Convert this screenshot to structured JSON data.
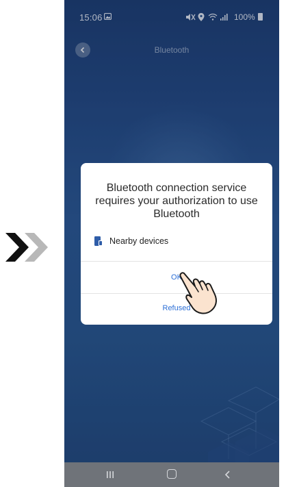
{
  "status_bar": {
    "time": "15:06",
    "battery": "100%",
    "icons": [
      "image-icon",
      "mute-icon",
      "location-icon",
      "wifi-icon",
      "signal-icon",
      "battery-icon"
    ]
  },
  "header": {
    "title": "Bluetooth",
    "back_icon": "back-arrow-icon"
  },
  "dialog": {
    "message": "Bluetooth connection service requires your authorization to use Bluetooth",
    "permission": {
      "icon": "nearby-devices-icon",
      "label": "Nearby devices"
    },
    "ok_label": "OK",
    "refused_label": "Refused"
  },
  "nav_bar": {
    "items": [
      "recents-icon",
      "home-icon",
      "back-icon"
    ]
  },
  "colors": {
    "accent": "#2c6fd6",
    "background_top": "#1d3f76",
    "background_bottom": "#22497f",
    "nav_bar": "#6f7379"
  }
}
